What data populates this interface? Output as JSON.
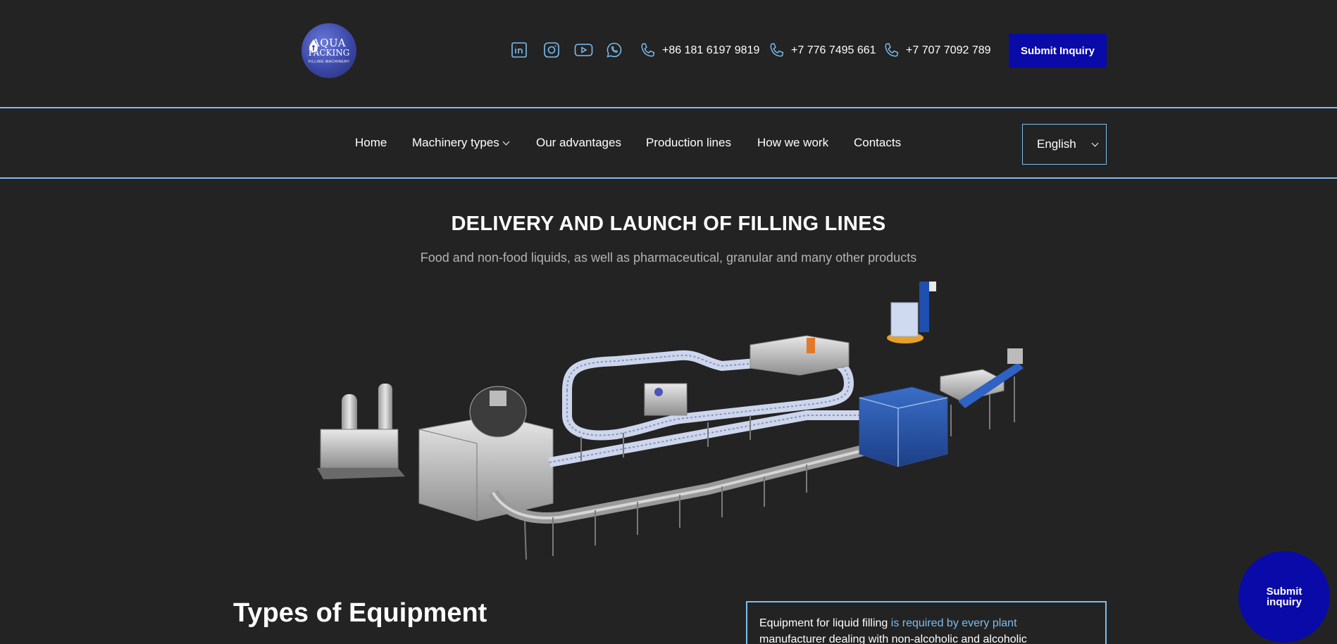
{
  "logo": {
    "line1": "AQUA",
    "line2": "PACKING",
    "line3": "FILLING MACHINERY"
  },
  "social": [
    "linkedin-icon",
    "instagram-icon",
    "youtube-icon",
    "whatsapp-icon"
  ],
  "phones": [
    "+86 181 6197 9819",
    "+7 776 7495 661",
    "+7 707 7092 789"
  ],
  "header": {
    "submit_label": "Submit Inquiry"
  },
  "nav": {
    "items": [
      "Home",
      "Machinery types",
      "Our advantages",
      "Production lines",
      "How we work",
      "Contacts"
    ],
    "language": "English"
  },
  "hero": {
    "title": "DELIVERY AND LAUNCH OF FILLING LINES",
    "subtitle": "Food and non-food liquids, as well as pharmaceutical, granular and many other products"
  },
  "section": {
    "title": "Types of Equipment",
    "box_text_1": "Equipment for liquid filling ",
    "box_text_hl": "is required by every plant",
    "box_text_2": "manufacturer dealing with non-alcoholic and alcoholic"
  },
  "fab": {
    "label": "Submit inquiry"
  },
  "colors": {
    "background": "#232323",
    "accent": "#7cbef0",
    "button": "#0a0aa8"
  }
}
